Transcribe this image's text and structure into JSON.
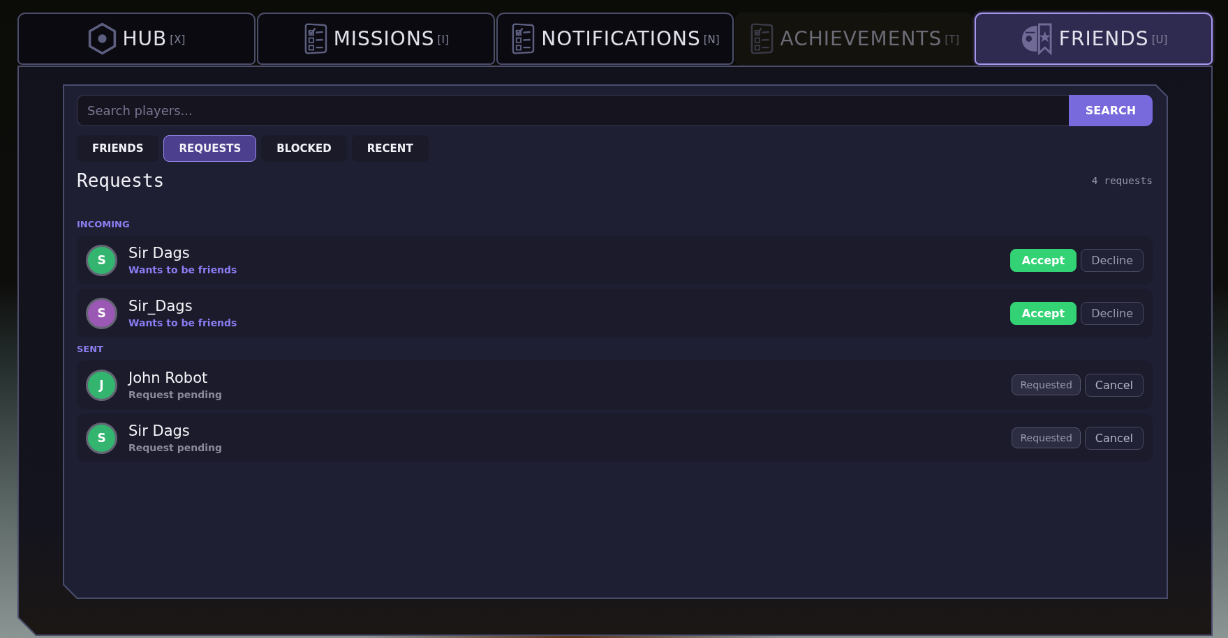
{
  "tabs": [
    {
      "label": "HUB",
      "hotkey": "[X]",
      "selected": false,
      "disabled": false
    },
    {
      "label": "MISSIONS",
      "hotkey": "[I]",
      "selected": false,
      "disabled": false
    },
    {
      "label": "NOTIFICATIONS",
      "hotkey": "[N]",
      "selected": false,
      "disabled": false
    },
    {
      "label": "ACHIEVEMENTS",
      "hotkey": "[T]",
      "selected": false,
      "disabled": true
    },
    {
      "label": "FRIENDS",
      "hotkey": "[U]",
      "selected": true,
      "disabled": false
    }
  ],
  "search": {
    "placeholder": "Search players...",
    "button": "SEARCH"
  },
  "filters": [
    {
      "label": "FRIENDS",
      "selected": false
    },
    {
      "label": "REQUESTS",
      "selected": true
    },
    {
      "label": "BLOCKED",
      "selected": false
    },
    {
      "label": "RECENT",
      "selected": false
    }
  ],
  "list": {
    "title": "Requests",
    "count": "4 requests",
    "sections": [
      {
        "label": "INCOMING",
        "kind": "incoming",
        "requests": [
          {
            "initial": "S",
            "name": "Sir Dags",
            "status": "Wants to be friends",
            "color": "#33b46f",
            "actions": [
              {
                "label": "Accept",
                "kind": "accept"
              },
              {
                "label": "Decline",
                "kind": "decline"
              }
            ]
          },
          {
            "initial": "S",
            "name": "Sir_Dags",
            "status": "Wants to be friends",
            "color": "#9b58b5",
            "actions": [
              {
                "label": "Accept",
                "kind": "accept"
              },
              {
                "label": "Decline",
                "kind": "decline"
              }
            ]
          }
        ]
      },
      {
        "label": "SENT",
        "kind": "sent",
        "requests": [
          {
            "initial": "J",
            "name": "John Robot",
            "status": "Request pending",
            "color": "#33b46f",
            "actions": [
              {
                "label": "Requested",
                "kind": "pending"
              },
              {
                "label": "Cancel",
                "kind": "cancel"
              }
            ]
          },
          {
            "initial": "S",
            "name": "Sir Dags",
            "status": "Request pending",
            "color": "#33b46f",
            "actions": [
              {
                "label": "Requested",
                "kind": "pending"
              },
              {
                "label": "Cancel",
                "kind": "cancel"
              }
            ]
          }
        ]
      }
    ]
  }
}
